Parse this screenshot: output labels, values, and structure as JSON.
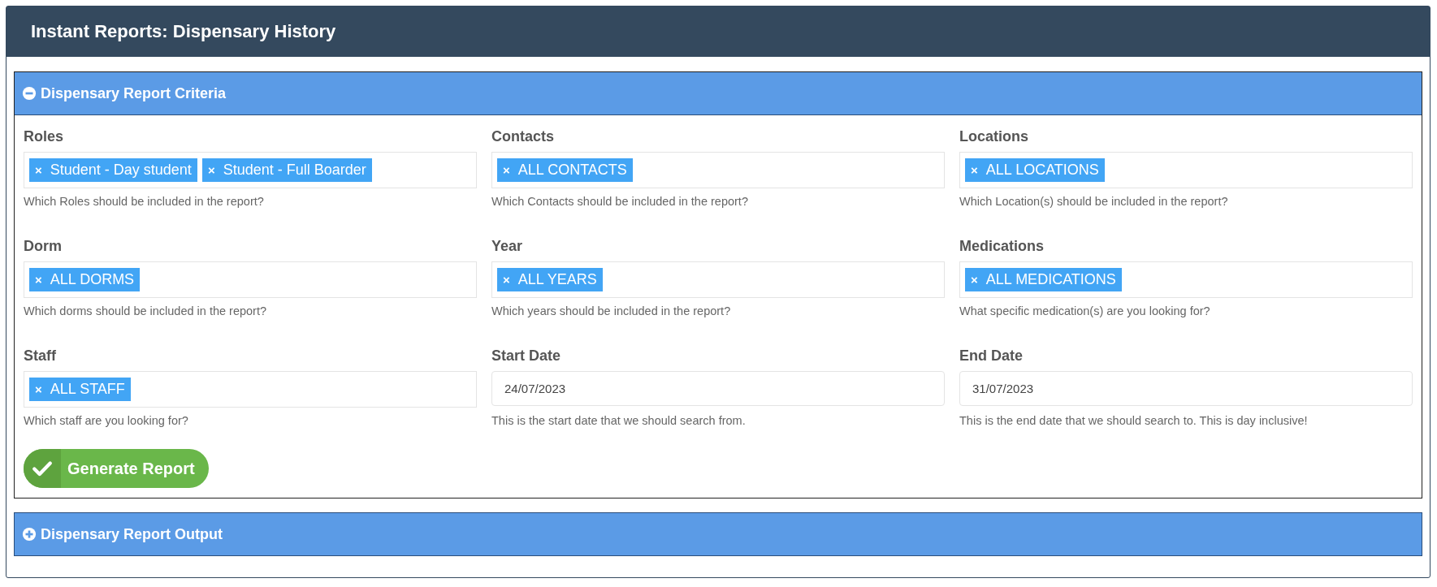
{
  "page": {
    "title": "Instant Reports: Dispensary History"
  },
  "criteria_panel": {
    "title": "Dispensary Report Criteria",
    "expanded": true,
    "fields": [
      {
        "kind": "tags",
        "label": "Roles",
        "tags": [
          "Student - Day student",
          "Student - Full Boarder"
        ],
        "help": "Which Roles should be included in the report?"
      },
      {
        "kind": "tags",
        "label": "Contacts",
        "tags": [
          "ALL CONTACTS"
        ],
        "help": "Which Contacts should be included in the report?"
      },
      {
        "kind": "tags",
        "label": "Locations",
        "tags": [
          "ALL LOCATIONS"
        ],
        "help": "Which Location(s) should be included in the report?"
      },
      {
        "kind": "tags",
        "label": "Dorm",
        "tags": [
          "ALL DORMS"
        ],
        "help": "Which dorms should be included in the report?"
      },
      {
        "kind": "tags",
        "label": "Year",
        "tags": [
          "ALL YEARS"
        ],
        "help": "Which years should be included in the report?"
      },
      {
        "kind": "tags",
        "label": "Medications",
        "tags": [
          "ALL MEDICATIONS"
        ],
        "help": "What specific medication(s) are you looking for?"
      },
      {
        "kind": "tags",
        "label": "Staff",
        "tags": [
          "ALL STAFF"
        ],
        "help": "Which staff are you looking for?"
      },
      {
        "kind": "date",
        "label": "Start Date",
        "value": "24/07/2023",
        "help": "This is the start date that we should search from."
      },
      {
        "kind": "date",
        "label": "End Date",
        "value": "31/07/2023",
        "help": "This is the end date that we should search to. This is day inclusive!"
      }
    ],
    "tag_remove_symbol": "×",
    "button": "Generate Report"
  },
  "output_panel": {
    "title": "Dispensary Report Output",
    "expanded": false
  }
}
